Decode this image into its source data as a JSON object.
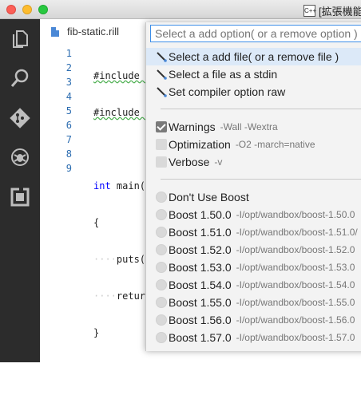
{
  "window": {
    "title": "[拡張機能]",
    "lang_badge": "C++"
  },
  "editor": {
    "tab_label": "fib-static.rill",
    "line_numbers": [
      "1",
      "2",
      "3",
      "4",
      "5",
      "6",
      "7",
      "8",
      "9"
    ],
    "lines": [
      "#include ",
      "#include ",
      "",
      "int main(",
      "{",
      "····puts(",
      "····retur",
      "}",
      ""
    ]
  },
  "dropdown": {
    "placeholder": "Select a add option( or a remove option )",
    "actions": [
      {
        "label": "Select a add file( or a remove file )",
        "icon": "brush-icon"
      },
      {
        "label": "Select a file as a stdin",
        "icon": "brush-icon"
      },
      {
        "label": "Set compiler option raw",
        "icon": "brush-icon"
      }
    ],
    "options": [
      {
        "label": "Warnings",
        "detail": "-Wall -Wextra",
        "checked": true
      },
      {
        "label": "Optimization",
        "detail": "-O2 -march=native",
        "checked": false
      },
      {
        "label": "Verbose",
        "detail": "-v",
        "checked": false
      }
    ],
    "boost": [
      {
        "label": "Don't Use Boost",
        "detail": ""
      },
      {
        "label": "Boost 1.50.0",
        "detail": "-I/opt/wandbox/boost-1.50.0"
      },
      {
        "label": "Boost 1.51.0",
        "detail": "-I/opt/wandbox/boost-1.51.0/"
      },
      {
        "label": "Boost 1.52.0",
        "detail": "-I/opt/wandbox/boost-1.52.0"
      },
      {
        "label": "Boost 1.53.0",
        "detail": "-I/opt/wandbox/boost-1.53.0"
      },
      {
        "label": "Boost 1.54.0",
        "detail": "-I/opt/wandbox/boost-1.54.0"
      },
      {
        "label": "Boost 1.55.0",
        "detail": "-I/opt/wandbox/boost-1.55.0"
      },
      {
        "label": "Boost 1.56.0",
        "detail": "-I/opt/wandbox/boost-1.56.0"
      },
      {
        "label": "Boost 1.57.0",
        "detail": "-I/opt/wandbox/boost-1.57.0"
      }
    ]
  },
  "activity_bar": {
    "icons": [
      "files-icon",
      "search-icon",
      "git-icon",
      "debug-icon",
      "extensions-icon"
    ]
  }
}
